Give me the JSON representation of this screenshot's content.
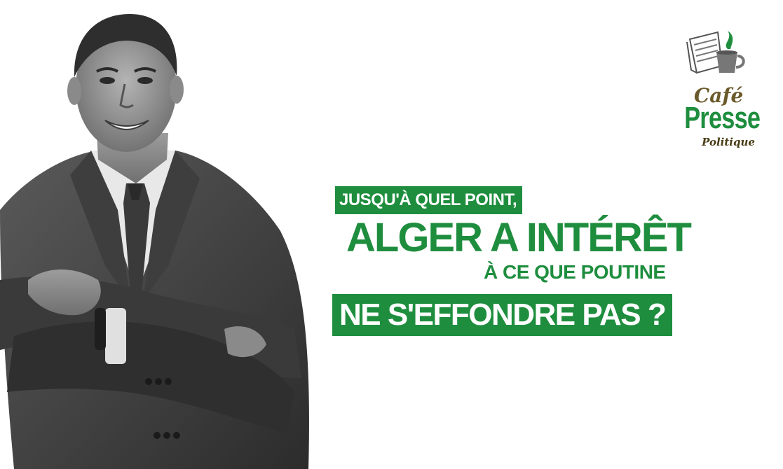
{
  "logo": {
    "icon": "newspaper-coffee-cup-icon",
    "line1": "Café",
    "line2": "Presse",
    "line3": "Politique",
    "colors": {
      "brown": "#6b5a2b",
      "green": "#1e8e3e"
    }
  },
  "headline": {
    "line1": "JUSQU'À QUEL POINT,",
    "line2": "ALGER A INTÉRÊT",
    "line3": "À CE QUE POUTINE",
    "line4": "NE S'EFFONDRE PAS ?",
    "colors": {
      "green": "#1e8e3e",
      "text_on_green": "#ffffff"
    }
  },
  "photo": {
    "subject": "man-in-suit-arms-crossed",
    "style": "grayscale"
  }
}
